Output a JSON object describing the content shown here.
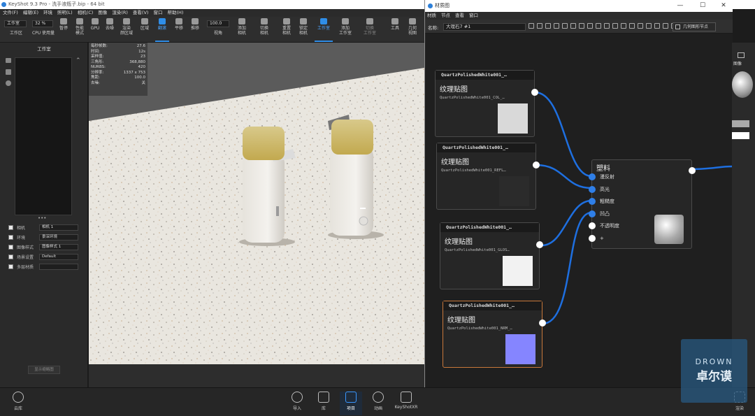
{
  "app": {
    "title": "KeyShot 9.3 Pro - 洗手液瓶子.bip - 64 bit",
    "menu": [
      "文件(F)",
      "编辑(E)",
      "环境",
      "照明(L)",
      "相机(C)",
      "图像",
      "渲染(R)",
      "查看(V)",
      "窗口",
      "帮助(H)"
    ]
  },
  "toolbar": {
    "workspace_select": "工作室",
    "workspace_label": "工作区",
    "cpu_value": "32 %",
    "cpu_label": "CPU 使用量",
    "pause": "暂停",
    "perf_mode": "性能\n模式",
    "gpu": "GPU",
    "denoise": "去噪",
    "render_regions": "渲染\n颜区域",
    "region": "区域",
    "tumble": "翻滚",
    "pan": "平移",
    "dolly": "推移",
    "fov_value": "100.0",
    "fov_label": "视角",
    "add_camera": "添加\n相机",
    "switch_camera": "切换\n相机",
    "reset_camera": "重置\n相机",
    "lock_camera": "锁定\n相机",
    "studio": "工作室",
    "add_studio": "添加\n工作室",
    "switch_studio": "切换\n工作室",
    "tools": "工具",
    "geo_view": "几何\n视图"
  },
  "left_panel": {
    "header": "工作室",
    "rows": [
      {
        "label": "相机",
        "value": "相机 1"
      },
      {
        "label": "环境",
        "value": "景深环境"
      },
      {
        "label": "图像样式",
        "value": "图像样式 1"
      },
      {
        "label": "场景设置",
        "value": "Default"
      },
      {
        "label": "多层材质",
        "value": ""
      }
    ],
    "bottom_button": "显示缩略图"
  },
  "stats": [
    {
      "k": "每秒帧数:",
      "v": "27.6"
    },
    {
      "k": "时间:",
      "v": "12s"
    },
    {
      "k": "采样值:",
      "v": "23"
    },
    {
      "k": "三角形:",
      "v": "368,880"
    },
    {
      "k": "NURBS:",
      "v": "420"
    },
    {
      "k": "分辨率:",
      "v": "1337 x 753"
    },
    {
      "k": "焦距:",
      "v": "100.0"
    },
    {
      "k": "去噪:",
      "v": "关"
    }
  ],
  "bottom_bar": {
    "cloud": "云库",
    "import": "导入",
    "library": "库",
    "project": "项目",
    "animation": "动画",
    "keyshotxr": "KeyShotXR",
    "render": "渲染"
  },
  "material_window": {
    "title": "材质图",
    "menu": [
      "材质",
      "节点",
      "查看",
      "窗口"
    ],
    "name_label": "名称:",
    "name_value": "大理石7 #1",
    "geo_node_button": "几何图形节点",
    "nodes": [
      {
        "header": "QuartzPolishedWhite001_…",
        "title": "纹理贴图",
        "file": "QuartzPolishedWhite001_COL_…",
        "swatch": "#d9d9d9"
      },
      {
        "header": "QuartzPolishedWhite001_…",
        "title": "纹理贴图",
        "file": "QuartzPolishedWhite001_REFL…",
        "swatch": "#2b2b2b"
      },
      {
        "header": "QuartzPolishedWhite001_…",
        "title": "纹理贴图",
        "file": "QuartzPolishedWhite001_GLOS…",
        "swatch": "#f2f2f2"
      },
      {
        "header": "QuartzPolishedWhite001_…",
        "title": "纹理贴图",
        "file": "QuartzPolishedWhite001_NRM_…",
        "swatch": "#8585ff"
      }
    ],
    "plastic": {
      "title": "塑料",
      "inputs": [
        "漫反射",
        "高光",
        "粗糙度",
        "凹凸",
        "不透明度",
        "+"
      ]
    }
  },
  "right_panel": {
    "image_label": "图像"
  },
  "watermark": {
    "line1": "DROWN",
    "line2": "卓尔谟"
  }
}
